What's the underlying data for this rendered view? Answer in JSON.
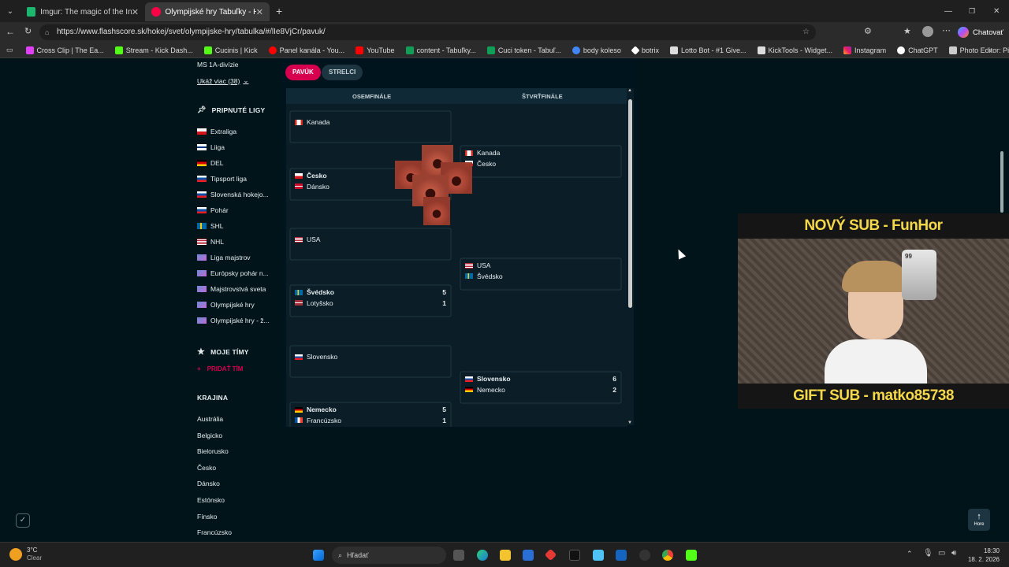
{
  "browser": {
    "tabs": [
      {
        "title": "Imgur: The magic of the Internet",
        "color": "#1bb76e"
      },
      {
        "title": "Olympijské hry Tabuľky - Hokej/S",
        "color": "#0a2b3a"
      }
    ],
    "url": "https://www.flashscore.sk/hokej/svet/olympijske-hry/tabulka/#/lIe8VjCr/pavuk/",
    "copilot_label": "Chatovať",
    "bookmarks": [
      "Cross Clip | The Ea...",
      "Stream - Kick Dash...",
      "Cucinis | Kick",
      "Panel kanála - You...",
      "YouTube",
      "content - Tabuľky...",
      "Cuci token - Tabuľ...",
      "body koleso",
      "botrix",
      "Lotto Bot - #1 Give...",
      "KickTools - Widget...",
      "Instagram",
      "ChatGPT",
      "Photo Editor: Pixlr..."
    ]
  },
  "sidebar": {
    "top_item": "MS 1A-divízie",
    "show_more": "Ukáž viac (38)",
    "pinned_title": "PRIPNUTÉ LIGY",
    "pinned": [
      {
        "label": "Extraliga",
        "flag": "cz"
      },
      {
        "label": "Liiga",
        "flag": "fi"
      },
      {
        "label": "DEL",
        "flag": "de"
      },
      {
        "label": "Tipsport liga",
        "flag": "sk"
      },
      {
        "label": "Slovenská hokejo...",
        "flag": "sk"
      },
      {
        "label": "Pohár",
        "flag": "sk"
      },
      {
        "label": "SHL",
        "flag": "se"
      },
      {
        "label": "NHL",
        "flag": "us"
      },
      {
        "label": "Liga majstrov",
        "flag": "eu"
      },
      {
        "label": "Európsky pohár n...",
        "flag": "eu"
      },
      {
        "label": "Majstrovstvá sveta",
        "flag": "eu"
      },
      {
        "label": "Olympijské hry",
        "flag": "eu"
      },
      {
        "label": "Olympijské hry - ž...",
        "flag": "eu"
      }
    ],
    "my_teams_title": "MOJE TÍMY",
    "add_team": "PRIDAŤ TÍM",
    "country_title": "KRAJINA",
    "countries": [
      "Austrália",
      "Belgicko",
      "Bielorusko",
      "Česko",
      "Dánsko",
      "Estónsko",
      "Fínsko",
      "Francúzsko"
    ]
  },
  "tabs": {
    "bracket": "PAVÚK",
    "scorers": "STRELCI"
  },
  "bracket": {
    "round1_title": "OSEMFINÁLE",
    "round2_title": "ŠTVRŤFINÁLE",
    "round1": [
      {
        "teams": [
          {
            "name": "Kanada",
            "flag": "ca",
            "score": "",
            "win": false
          }
        ]
      },
      {
        "teams": [
          {
            "name": "Česko",
            "flag": "cz",
            "score": "",
            "win": true
          },
          {
            "name": "Dánsko",
            "flag": "dk",
            "score": "",
            "win": false
          }
        ]
      },
      {
        "teams": [
          {
            "name": "USA",
            "flag": "us",
            "score": "",
            "win": false
          }
        ]
      },
      {
        "teams": [
          {
            "name": "Švédsko",
            "flag": "se",
            "score": "5",
            "win": true
          },
          {
            "name": "Lotyšsko",
            "flag": "lv",
            "score": "1",
            "win": false
          }
        ]
      },
      {
        "teams": [
          {
            "name": "Slovensko",
            "flag": "sk",
            "score": "",
            "win": false
          }
        ]
      },
      {
        "teams": [
          {
            "name": "Nemecko",
            "flag": "de",
            "score": "5",
            "win": true
          },
          {
            "name": "Francúzsko",
            "flag": "fr",
            "score": "1",
            "win": false
          }
        ]
      }
    ],
    "round2": [
      {
        "teams": [
          {
            "name": "Kanada",
            "flag": "ca",
            "score": "",
            "win": false
          },
          {
            "name": "Česko",
            "flag": "cz",
            "score": "",
            "win": false
          }
        ]
      },
      {
        "teams": [
          {
            "name": "USA",
            "flag": "us",
            "score": "",
            "win": false
          },
          {
            "name": "Švédsko",
            "flag": "se",
            "score": "",
            "win": false
          }
        ]
      },
      {
        "teams": [
          {
            "name": "Slovensko",
            "flag": "sk",
            "score": "6",
            "win": true
          },
          {
            "name": "Nemecko",
            "flag": "de",
            "score": "2",
            "win": false
          }
        ]
      }
    ]
  },
  "stream_overlay": {
    "new_sub": "NOVÝ SUB - FunHor",
    "gift_sub": "GIFT SUB - matko85738",
    "card_rating": "99"
  },
  "back_to_top": "Hore",
  "taskbar": {
    "temp": "3°C",
    "weather": "Clear",
    "search_placeholder": "Hľadať",
    "time": "18:30",
    "date": "18. 2. 2026"
  },
  "colors": {
    "accent": "#d6004f",
    "page_bg": "#001419",
    "panel_bg": "#0b1e28"
  }
}
